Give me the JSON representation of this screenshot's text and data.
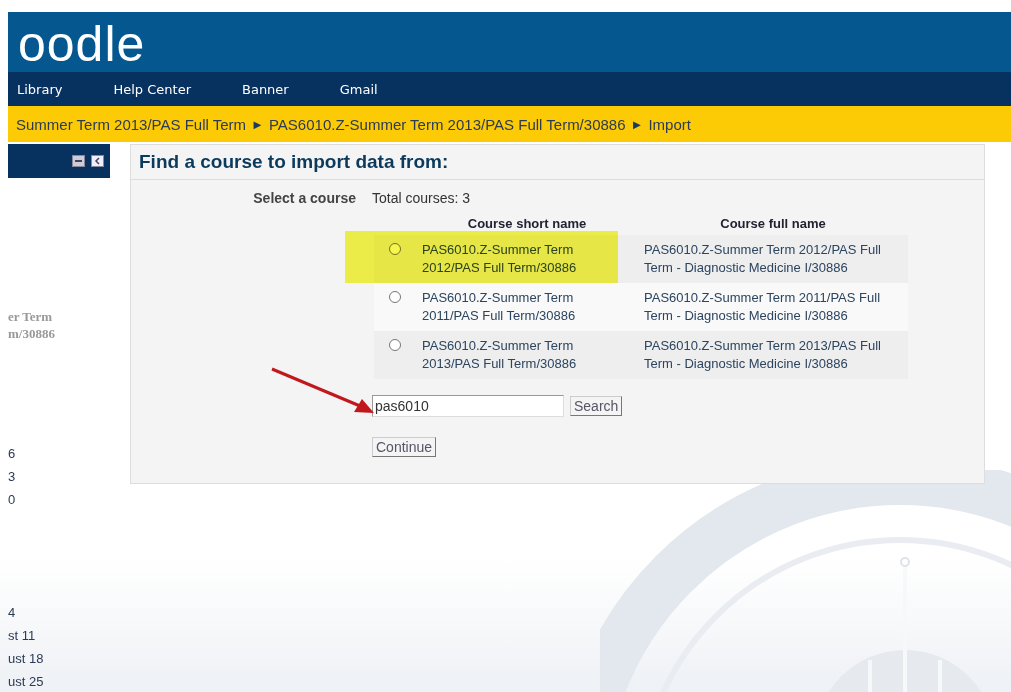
{
  "logo": {
    "text": "oodle"
  },
  "nav": [
    "Library",
    "Help Center",
    "Banner",
    "Gmail"
  ],
  "breadcrumb": [
    "Summer Term 2013/PAS Full Term",
    "PAS6010.Z-Summer Term 2013/PAS Full Term/30886",
    "Import"
  ],
  "breadcrumb_separator": "►",
  "sidebar": {
    "groups": [
      [
        "er Term",
        "m/30886"
      ],
      [
        "6",
        "3",
        "0"
      ],
      [
        "4",
        "st 11",
        "ust 18",
        "ust 25"
      ]
    ]
  },
  "panel": {
    "title": "Find a course to import data from:",
    "select_label": "Select a course",
    "total": "Total courses: 3",
    "columns": [
      "Course short name",
      "Course full name"
    ],
    "rows": [
      {
        "short": "PAS6010.Z-Summer Term 2012/PAS Full Term/30886",
        "full": "PAS6010.Z-Summer Term 2012/PAS Full Term - Diagnostic Medicine I/30886",
        "selected": false,
        "highlighted": true
      },
      {
        "short": "PAS6010.Z-Summer Term 2011/PAS Full Term/30886",
        "full": "PAS6010.Z-Summer Term 2011/PAS Full Term - Diagnostic Medicine I/30886",
        "selected": false,
        "highlighted": false
      },
      {
        "short": "PAS6010.Z-Summer Term 2013/PAS Full Term/30886",
        "full": "PAS6010.Z-Summer Term 2013/PAS Full Term - Diagnostic Medicine I/30886",
        "selected": false,
        "highlighted": false
      }
    ],
    "search_value": "pas6010",
    "search_button": "Search",
    "continue_button": "Continue"
  }
}
